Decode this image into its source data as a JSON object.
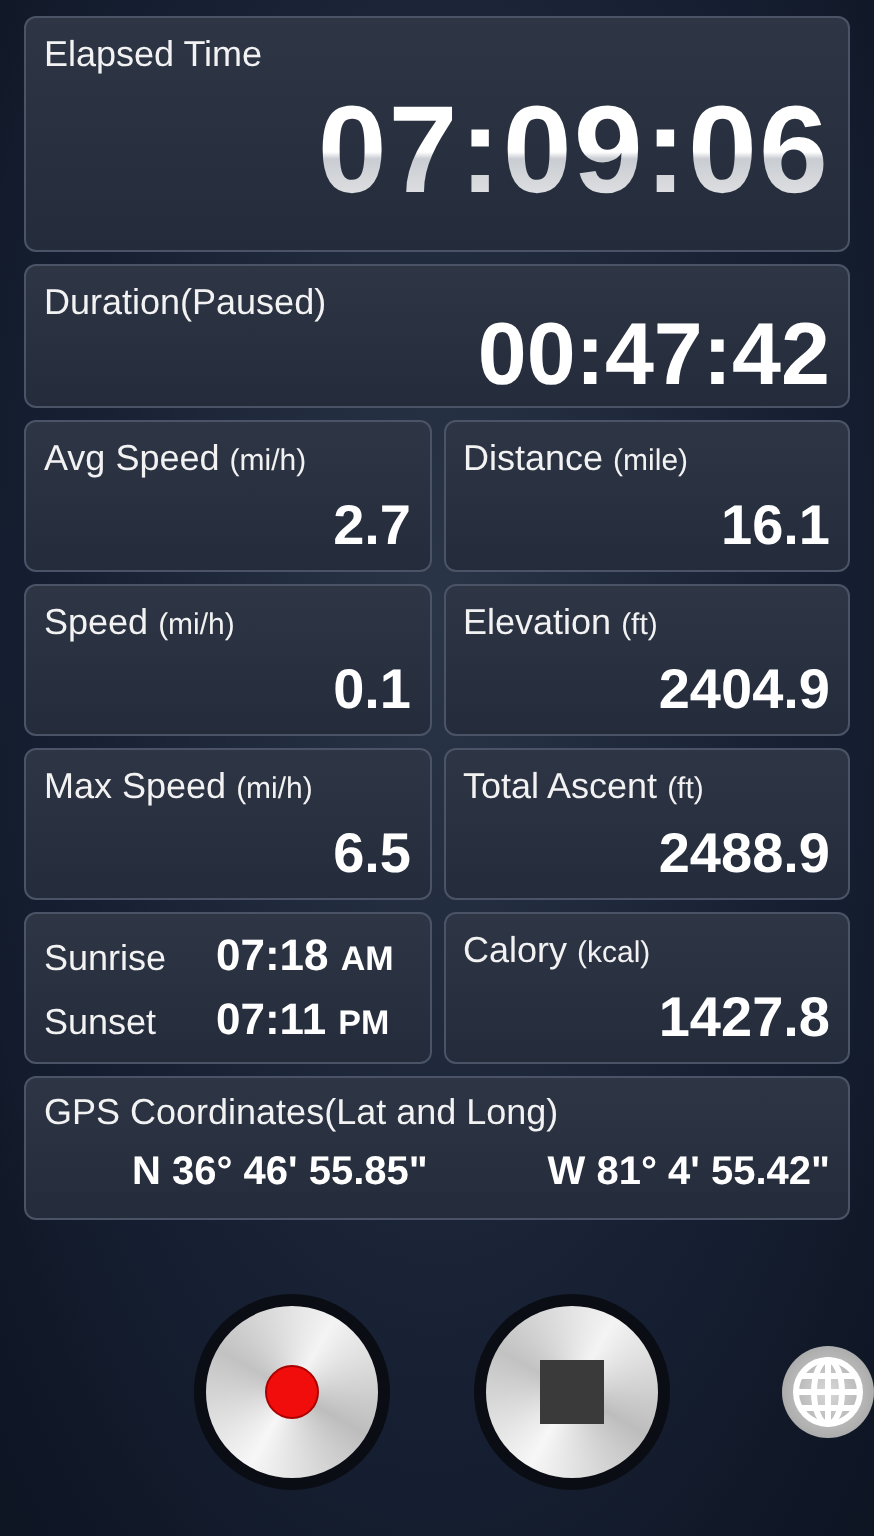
{
  "elapsed": {
    "label": "Elapsed Time",
    "value": "07:09:06"
  },
  "duration": {
    "label": "Duration(Paused)",
    "value": "00:47:42"
  },
  "tiles": [
    {
      "kind": "stat",
      "label": "Avg Speed",
      "unit": "(mi/h)",
      "value": "2.7"
    },
    {
      "kind": "stat",
      "label": "Distance",
      "unit": "(mile)",
      "value": "16.1"
    },
    {
      "kind": "stat",
      "label": "Speed",
      "unit": "(mi/h)",
      "value": "0.1"
    },
    {
      "kind": "stat",
      "label": "Elevation",
      "unit": "(ft)",
      "value": "2404.9"
    },
    {
      "kind": "stat",
      "label": "Max Speed",
      "unit": "(mi/h)",
      "value": "6.5"
    },
    {
      "kind": "stat",
      "label": "Total Ascent",
      "unit": "(ft)",
      "value": "2488.9"
    },
    {
      "kind": "sun",
      "rows": [
        {
          "label": "Sunrise",
          "time": "07:18",
          "period": "AM"
        },
        {
          "label": "Sunset",
          "time": "07:11",
          "period": "PM"
        }
      ]
    },
    {
      "kind": "stat",
      "label": "Calory",
      "unit": "(kcal)",
      "value": "1427.8"
    }
  ],
  "gps": {
    "label": "GPS Coordinates(Lat and Long)",
    "lat": "N 36° 46' 55.85\"",
    "long": "W 81° 4' 55.42\""
  }
}
